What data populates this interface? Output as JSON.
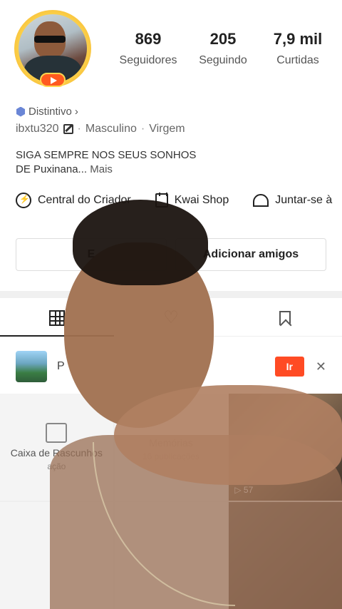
{
  "profile": {
    "stats": [
      {
        "value": "869",
        "label": "Seguidores"
      },
      {
        "value": "205",
        "label": "Seguindo"
      },
      {
        "value": "7,9 mil",
        "label": "Curtidas"
      }
    ],
    "badge_label": "Distintivo",
    "badge_chevron": "›",
    "username": "ibxtu320",
    "gender": "Masculino",
    "sign": "Virgem",
    "separator": "·",
    "bio_line1": "SIGA SEMPRE NOS SEUS SONHOS",
    "bio_line2": "DE Puxinana...",
    "bio_more": "Mais"
  },
  "actions": [
    {
      "label": "Central do Criador",
      "icon": "bolt-icon"
    },
    {
      "label": "Kwai Shop",
      "icon": "shopping-bag-icon"
    },
    {
      "label": "Juntar-se à",
      "icon": "tent-icon"
    }
  ],
  "buttons": {
    "edit_label": "E",
    "add_friends_label": "Adicionar amigos"
  },
  "tabs": [
    "grid-icon",
    "heart-icon",
    "bookmark-icon"
  ],
  "promo": {
    "text": "P",
    "go_label": "Ir",
    "close_label": "✕"
  },
  "feed": {
    "drafts_title": "Caixa de Rascunhos",
    "drafts_sub": "ação",
    "memories_title": "Memórias",
    "memories_sub": "16 publicações",
    "video_views": "▷ 57"
  },
  "colors": {
    "accent": "#ff4b24",
    "avatar_ring": "#fbd34d",
    "badge": "#6a86d6"
  }
}
